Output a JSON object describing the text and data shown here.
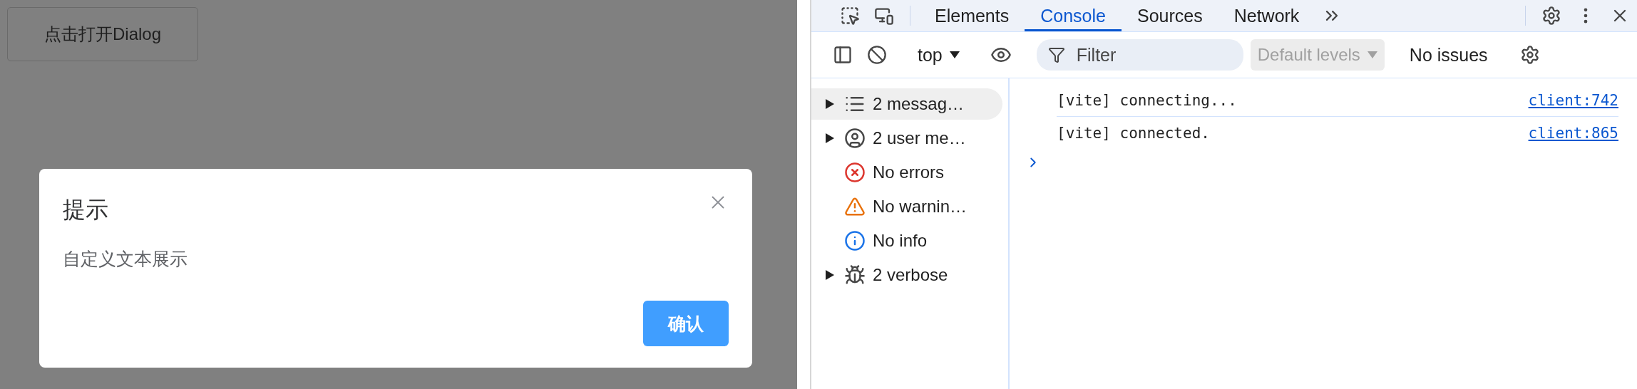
{
  "page": {
    "open_button": "点击打开Dialog"
  },
  "dialog": {
    "title": "提示",
    "message": "自定义文本展示",
    "confirm": "确认"
  },
  "devtools": {
    "tabs": [
      {
        "label": "Elements",
        "selected": false
      },
      {
        "label": "Console",
        "selected": true
      },
      {
        "label": "Sources",
        "selected": false
      },
      {
        "label": "Network",
        "selected": false
      }
    ],
    "toolbar": {
      "context": "top",
      "filter_placeholder": "Filter",
      "levels": {
        "label": "Default levels",
        "disabled": true
      },
      "issues": "No issues"
    },
    "sidebar": [
      {
        "kind": "messages",
        "label": "2 messag…",
        "expandable": true,
        "selected": true
      },
      {
        "kind": "user",
        "label": "2 user me…",
        "expandable": true,
        "selected": false
      },
      {
        "kind": "errors",
        "label": "No errors",
        "expandable": false,
        "selected": false
      },
      {
        "kind": "warnings",
        "label": "No warnin…",
        "expandable": false,
        "selected": false
      },
      {
        "kind": "info",
        "label": "No info",
        "expandable": false,
        "selected": false
      },
      {
        "kind": "verbose",
        "label": "2 verbose",
        "expandable": true,
        "selected": false
      }
    ],
    "console": [
      {
        "text": "[vite] connecting...",
        "source": "client:742"
      },
      {
        "text": "[vite] connected.",
        "source": "client:865"
      }
    ]
  }
}
